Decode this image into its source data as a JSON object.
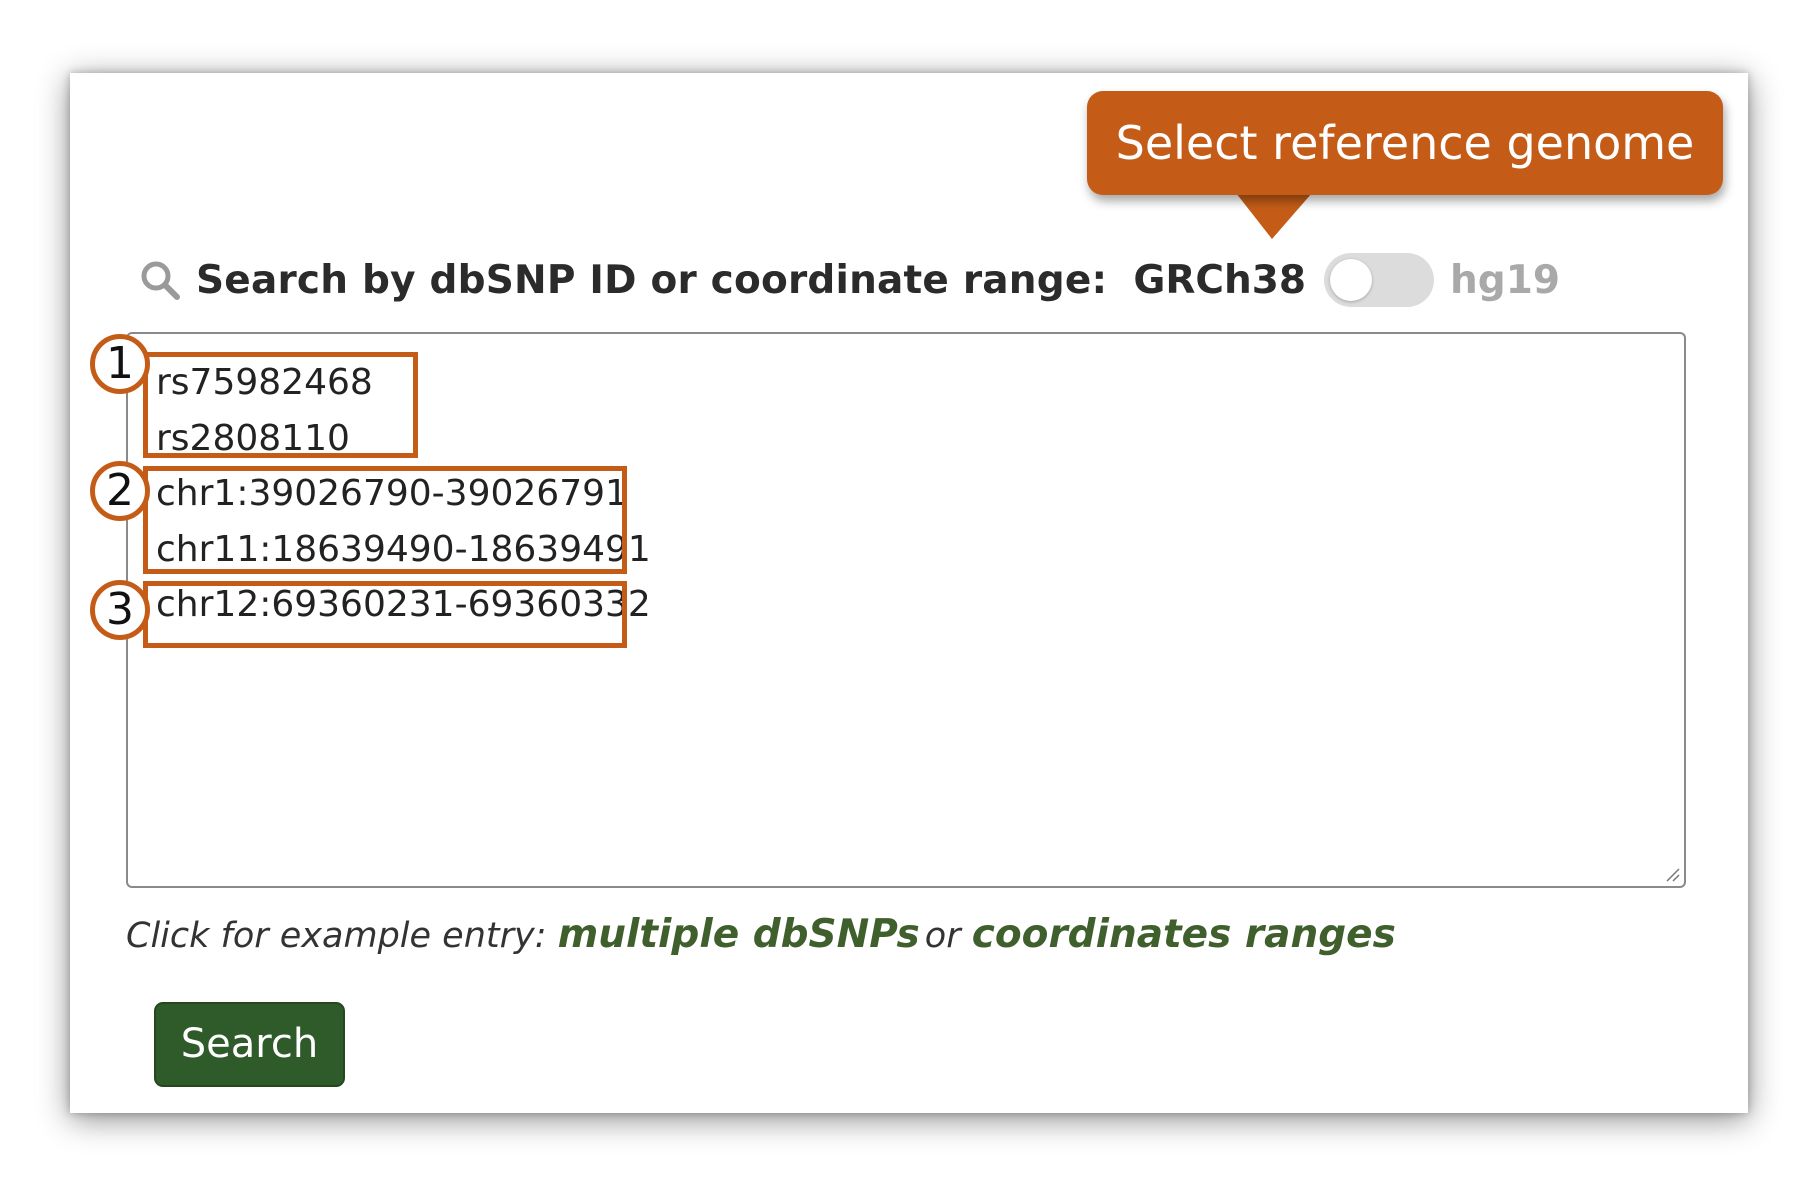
{
  "callout": {
    "text": "Select reference genome"
  },
  "search": {
    "label": "Search by dbSNP ID or coordinate range:",
    "genome_active": "GRCh38",
    "genome_inactive": "hg19",
    "toggle_on": false
  },
  "query": {
    "lines": [
      "rs75982468",
      "rs2808110",
      "chr1:39026790-39026791",
      "chr11:18639490-18639491",
      "chr12:69360231-69360332"
    ]
  },
  "annotations": {
    "badges": [
      "1",
      "2",
      "3"
    ]
  },
  "examples": {
    "prefix": "Click for example entry:",
    "link_dbsnps": "multiple dbSNPs",
    "or_text": "or",
    "link_coordinates": "coordinates ranges"
  },
  "buttons": {
    "search_label": "Search"
  },
  "colors": {
    "annotation": "#c45c17",
    "link_green": "#3f5f2c",
    "button_green": "#2f5a2a"
  }
}
